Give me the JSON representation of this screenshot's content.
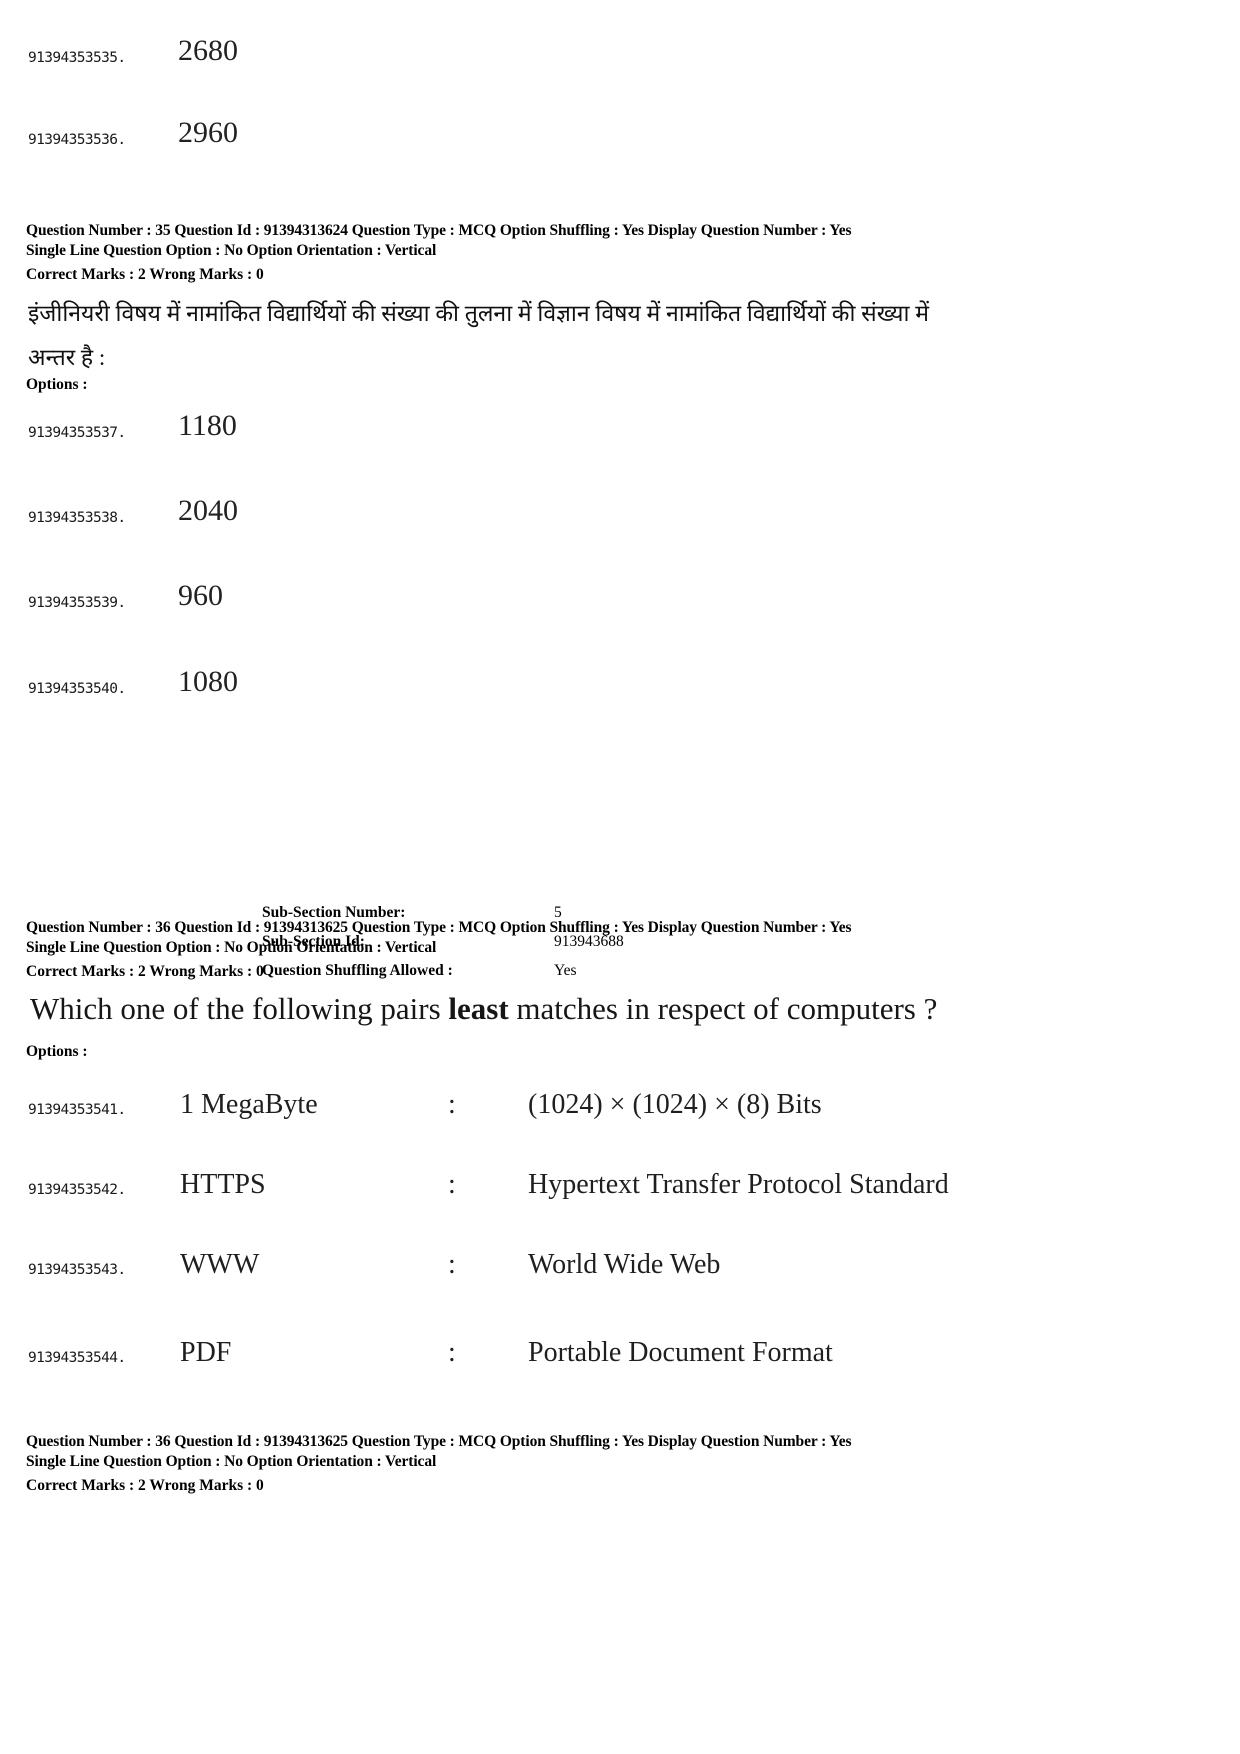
{
  "document": {
    "type": "exam-question-paper"
  },
  "top_options": {
    "label": "",
    "items": [
      {
        "id": "91394353535.",
        "value": "2680"
      },
      {
        "id": "91394353536.",
        "value": "2960"
      }
    ]
  },
  "question35": {
    "meta_line1": "Question Number : 35  Question Id : 91394313624  Question Type : MCQ  Option Shuffling : Yes  Display Question Number : Yes",
    "meta_line2": "Single Line Question Option : No  Option Orientation : Vertical",
    "marks": "Correct Marks : 2  Wrong Marks : 0",
    "stem_line1": "इंजीनियरी विषय में नामांकित विद्यार्थियों की संख्या की तुलना में विज्ञान विषय में नामांकित विद्यार्थियों की संख्या में",
    "stem_line2": "अन्तर है :",
    "options_label": "Options :",
    "options": [
      {
        "id": "91394353537.",
        "value": "1180"
      },
      {
        "id": "91394353538.",
        "value": "2040"
      },
      {
        "id": "91394353539.",
        "value": "960"
      },
      {
        "id": "91394353540.",
        "value": "1080"
      }
    ]
  },
  "subsection": {
    "rows": [
      {
        "key": "Sub-Section Number:",
        "value": "5"
      },
      {
        "key": "Sub-Section Id:",
        "value": "913943688"
      },
      {
        "key": "Question Shuffling Allowed :",
        "value": "Yes"
      }
    ]
  },
  "question36": {
    "meta_line1": "Question Number : 36  Question Id : 91394313625  Question Type : MCQ  Option Shuffling : Yes  Display Question Number : Yes",
    "meta_line2": "Single Line Question Option : No  Option Orientation : Vertical",
    "marks": "Correct Marks : 2  Wrong Marks : 0",
    "stem_pre": "Which one of the following pairs ",
    "stem_bold": "least",
    "stem_post": " matches in respect of computers ?",
    "options_label": "Options :",
    "options": [
      {
        "id": "91394353541.",
        "left": "1 MegaByte",
        "colon": ":",
        "right": "(1024) × (1024) × (8)  Bits"
      },
      {
        "id": "91394353542.",
        "left": "HTTPS",
        "colon": ":",
        "right": "Hypertext Transfer Protocol Standard"
      },
      {
        "id": "91394353543.",
        "left": "WWW",
        "colon": ":",
        "right": "World Wide Web"
      },
      {
        "id": "91394353544.",
        "left": "PDF",
        "colon": ":",
        "right": "Portable Document Format"
      }
    ]
  },
  "footer": {
    "meta_line1": "Question Number : 36  Question Id : 91394313625  Question Type : MCQ  Option Shuffling : Yes  Display Question Number : Yes",
    "meta_line2": "Single Line Question Option : No  Option Orientation : Vertical",
    "marks": "Correct Marks : 2  Wrong Marks : 0"
  }
}
